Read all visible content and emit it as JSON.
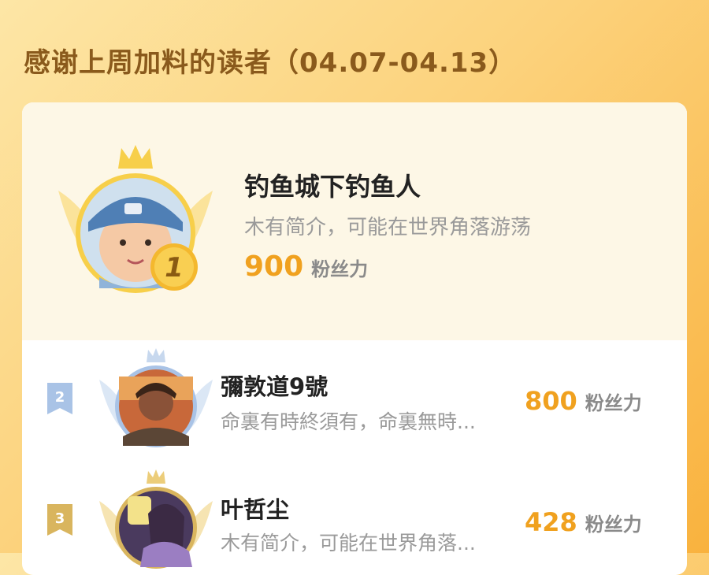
{
  "title": "感谢上周加料的读者（04.07-04.13）",
  "colors": {
    "accent": "#f0a11f",
    "title": "#8a5a1c",
    "top_bg": "#fdf7e6",
    "gold": "#f5c342",
    "silver": "#a9c3e6",
    "bronze": "#d9b55e"
  },
  "readers": [
    {
      "rank": "1",
      "name": "钓鱼城下钓鱼人",
      "bio": "木有简介，可能在世界角落游荡",
      "fans": "900",
      "fans_label": "粉丝力"
    },
    {
      "rank": "2",
      "name": "彌敦道9號",
      "bio": "命裏有時終須有，命裏無時...",
      "fans": "800",
      "fans_label": "粉丝力"
    },
    {
      "rank": "3",
      "name": "叶哲尘",
      "bio": "木有简介，可能在世界角落...",
      "fans": "428",
      "fans_label": "粉丝力"
    }
  ]
}
